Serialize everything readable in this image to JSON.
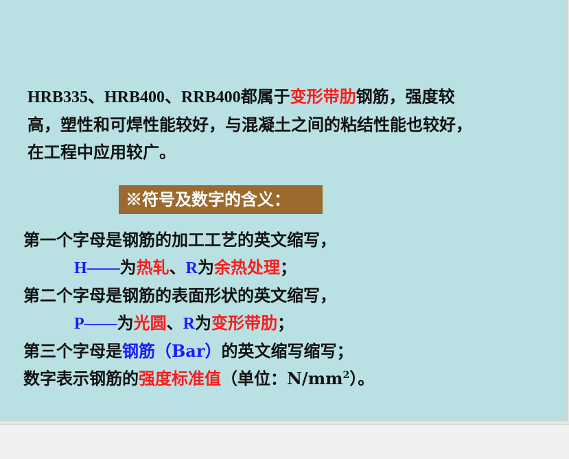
{
  "intro": {
    "line1_a": "HRB335、HRB400、RRB400",
    "line1_b": "都属于",
    "line1_red": "变形带肋",
    "line1_c": "钢筋，强度较",
    "line2": "高，塑性和可焊性能较好，与混凝土之间的粘结性能也较好，",
    "line3": "在工程中应用较广。"
  },
  "banner": {
    "text": "※符号及数字的含义："
  },
  "list": {
    "row1": "第一个字母是钢筋的加工工艺的英文缩写，",
    "row2_h": "H——",
    "row2_wei1": "为",
    "row2_red1": "热轧",
    "row2_sep": "、",
    "row2_r": "R",
    "row2_wei2": "为",
    "row2_red2": "余热处理",
    "row2_end": "；",
    "row3": "第二个字母是钢筋的表面形状的英文缩写，",
    "row4_p": "P——",
    "row4_wei1": "为",
    "row4_red1": "光圆",
    "row4_sep": "、",
    "row4_r": "R",
    "row4_wei2": "为",
    "row4_red2": "变形带肋",
    "row4_end": "；",
    "row5_a": "第三个字母是",
    "row5_blue": "钢筋（Bar）",
    "row5_b": "的英文缩写缩写；",
    "row6_a": "数字表示钢筋的",
    "row6_red": "强度标准值",
    "row6_b": "（单位：N/mm",
    "row6_sup": "2",
    "row6_c": "）。"
  },
  "colors": {
    "slide_bg": "#b9e1e4",
    "banner_bg": "#9c6a2f",
    "red": "#ff1a1a",
    "blue": "#1a1aff"
  }
}
